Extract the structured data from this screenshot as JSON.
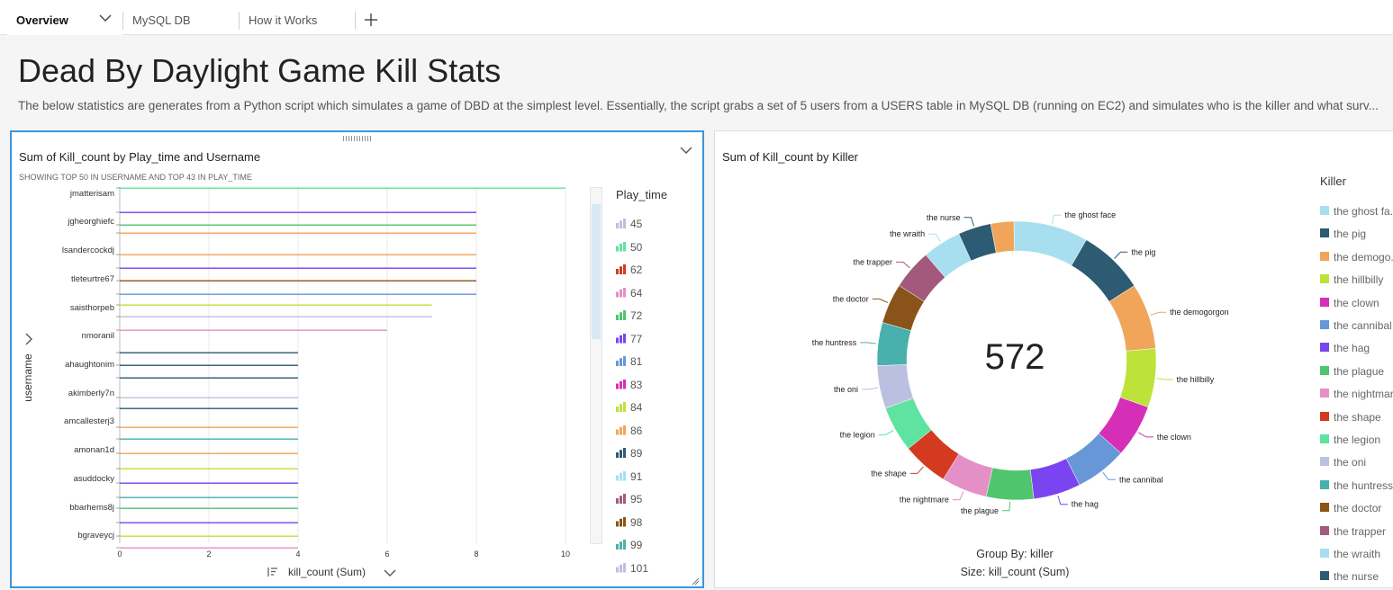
{
  "tabs": [
    {
      "label": "Overview",
      "active": true
    },
    {
      "label": "MySQL DB",
      "active": false
    },
    {
      "label": "How it Works",
      "active": false
    }
  ],
  "page": {
    "title": "Dead By Daylight Game Kill Stats",
    "description": "The below statistics are generates from a Python script which simulates a game of DBD at the simplest level. Essentially, the script grabs a set of 5 users from a USERS table in MySQL DB (running on EC2) and simulates who is the killer and what surv..."
  },
  "left_visual": {
    "title": "Sum of Kill_count by Play_time and Username",
    "subtitle": "SHOWING TOP 50 IN USERNAME AND TOP 43 IN PLAY_TIME",
    "y_axis_title": "username",
    "x_axis_title": "kill_count (Sum)",
    "legend_title": "Play_time",
    "legend": [
      {
        "label": "45",
        "color": "#bcc0e0"
      },
      {
        "label": "50",
        "color": "#5fe3a1"
      },
      {
        "label": "62",
        "color": "#d33a1f"
      },
      {
        "label": "64",
        "color": "#e58fc7"
      },
      {
        "label": "72",
        "color": "#4fc56d"
      },
      {
        "label": "77",
        "color": "#7a44f0"
      },
      {
        "label": "81",
        "color": "#6897d8"
      },
      {
        "label": "83",
        "color": "#d52fb8"
      },
      {
        "label": "84",
        "color": "#bde23a"
      },
      {
        "label": "86",
        "color": "#f0a55a"
      },
      {
        "label": "89",
        "color": "#2d5b73"
      },
      {
        "label": "91",
        "color": "#a8dff0"
      },
      {
        "label": "95",
        "color": "#a3597c"
      },
      {
        "label": "98",
        "color": "#8a5319"
      },
      {
        "label": "99",
        "color": "#48b0ad"
      },
      {
        "label": "101",
        "color": "#bcc0e0"
      }
    ]
  },
  "right_visual": {
    "title": "Sum of Kill_count by Killer",
    "center_value": "572",
    "footer_group": "Group By: killer",
    "footer_size": "Size: kill_count (Sum)",
    "legend_title": "Killer",
    "legend": [
      {
        "label": "the ghost fa...",
        "color": "#a8dff0"
      },
      {
        "label": "the pig",
        "color": "#2d5b73"
      },
      {
        "label": "the demogo...",
        "color": "#f0a55a"
      },
      {
        "label": "the hillbilly",
        "color": "#bde23a"
      },
      {
        "label": "the clown",
        "color": "#d52fb8"
      },
      {
        "label": "the cannibal",
        "color": "#6897d8"
      },
      {
        "label": "the hag",
        "color": "#7a44f0"
      },
      {
        "label": "the plague",
        "color": "#4fc56d"
      },
      {
        "label": "the nightmar...",
        "color": "#e58fc7"
      },
      {
        "label": "the shape",
        "color": "#d33a1f"
      },
      {
        "label": "the legion",
        "color": "#5fe3a1"
      },
      {
        "label": "the oni",
        "color": "#bcc0e0"
      },
      {
        "label": "the huntress",
        "color": "#48b0ad"
      },
      {
        "label": "the doctor",
        "color": "#8a5319"
      },
      {
        "label": "the trapper",
        "color": "#a3597c"
      },
      {
        "label": "the wraith",
        "color": "#a8dff0"
      },
      {
        "label": "the nurse",
        "color": "#2d5b73"
      }
    ]
  },
  "chart_data": [
    {
      "type": "bar",
      "title": "Sum of Kill_count by Play_time and Username",
      "subtitle": "SHOWING TOP 50 IN USERNAME AND TOP 43 IN PLAY_TIME",
      "xlabel": "kill_count (Sum)",
      "ylabel": "username",
      "xlim": [
        0,
        10
      ],
      "xticks": [
        0,
        2,
        4,
        6,
        8,
        10
      ],
      "grid": true,
      "categories": [
        "jmatterisam",
        "jgheorghiefc",
        "lsandercockdj",
        "tleteurtre67",
        "saisthorpeb",
        "nmoranil",
        "ahaughtonim",
        "akimberly7n",
        "amcallesterj3",
        "amonan1d",
        "asuddocky",
        "bbarhems8j",
        "bgraveycj"
      ],
      "bars": [
        {
          "value": 10,
          "color": "#5fe3a1"
        },
        {
          "value": 8,
          "color": "#7a44f0"
        },
        {
          "value": 8,
          "color": "#4fc56d"
        },
        {
          "value": 8,
          "color": "#f0a55a"
        },
        {
          "value": 8,
          "color": "#f0a55a"
        },
        {
          "value": 8,
          "color": "#7a44f0"
        },
        {
          "value": 8,
          "color": "#8a5319"
        },
        {
          "value": 8,
          "color": "#6897d8"
        },
        {
          "value": 7,
          "color": "#bde23a"
        },
        {
          "value": 7,
          "color": "#bcc0e0"
        },
        {
          "value": 6,
          "color": "#e58fc7"
        },
        {
          "value": 4,
          "color": "#2d5b73"
        },
        {
          "value": 4,
          "color": "#2d5b73"
        },
        {
          "value": 4,
          "color": "#2d5b73"
        },
        {
          "value": 4,
          "color": "#bcc0e0"
        },
        {
          "value": 4,
          "color": "#2d5b73"
        },
        {
          "value": 4,
          "color": "#f0a55a"
        },
        {
          "value": 4,
          "color": "#48b0ad"
        },
        {
          "value": 4,
          "color": "#f0a55a"
        },
        {
          "value": 4,
          "color": "#bde23a"
        },
        {
          "value": 4,
          "color": "#7a44f0"
        },
        {
          "value": 4,
          "color": "#48b0ad"
        },
        {
          "value": 4,
          "color": "#4fc56d"
        },
        {
          "value": 4,
          "color": "#7a44f0"
        },
        {
          "value": 4,
          "color": "#bde23a"
        },
        {
          "value": 4,
          "color": "#e58fc7"
        }
      ],
      "legend_title": "Play_time",
      "legend": [
        "45",
        "50",
        "62",
        "64",
        "72",
        "77",
        "81",
        "83",
        "84",
        "86",
        "89",
        "91",
        "95",
        "98",
        "99",
        "101"
      ]
    },
    {
      "type": "pie",
      "title": "Sum of Kill_count by Killer",
      "total": 572,
      "labels": [
        "the ghost face",
        "the pig",
        "the demogorgon",
        "the hillbilly",
        "the clown",
        "the cannibal",
        "the hag",
        "the plague",
        "the nightmare",
        "the shape",
        "the legion",
        "the oni",
        "the huntress",
        "the doctor",
        "the trapper",
        "the wraith",
        "the nurse",
        "the demogorgon"
      ],
      "values": [
        52,
        46,
        46,
        41,
        37,
        36,
        33,
        33,
        32,
        32,
        32,
        30,
        30,
        28,
        28,
        27,
        23,
        16
      ],
      "colors": [
        "#a8dff0",
        "#2d5b73",
        "#f0a55a",
        "#bde23a",
        "#d52fb8",
        "#6897d8",
        "#7a44f0",
        "#4fc56d",
        "#e58fc7",
        "#d33a1f",
        "#5fe3a1",
        "#bcc0e0",
        "#48b0ad",
        "#8a5319",
        "#a3597c",
        "#a8dff0",
        "#2d5b73",
        "#f0a55a"
      ],
      "legend_title": "Killer",
      "footer": [
        "Group By: killer",
        "Size: kill_count (Sum)"
      ]
    }
  ]
}
